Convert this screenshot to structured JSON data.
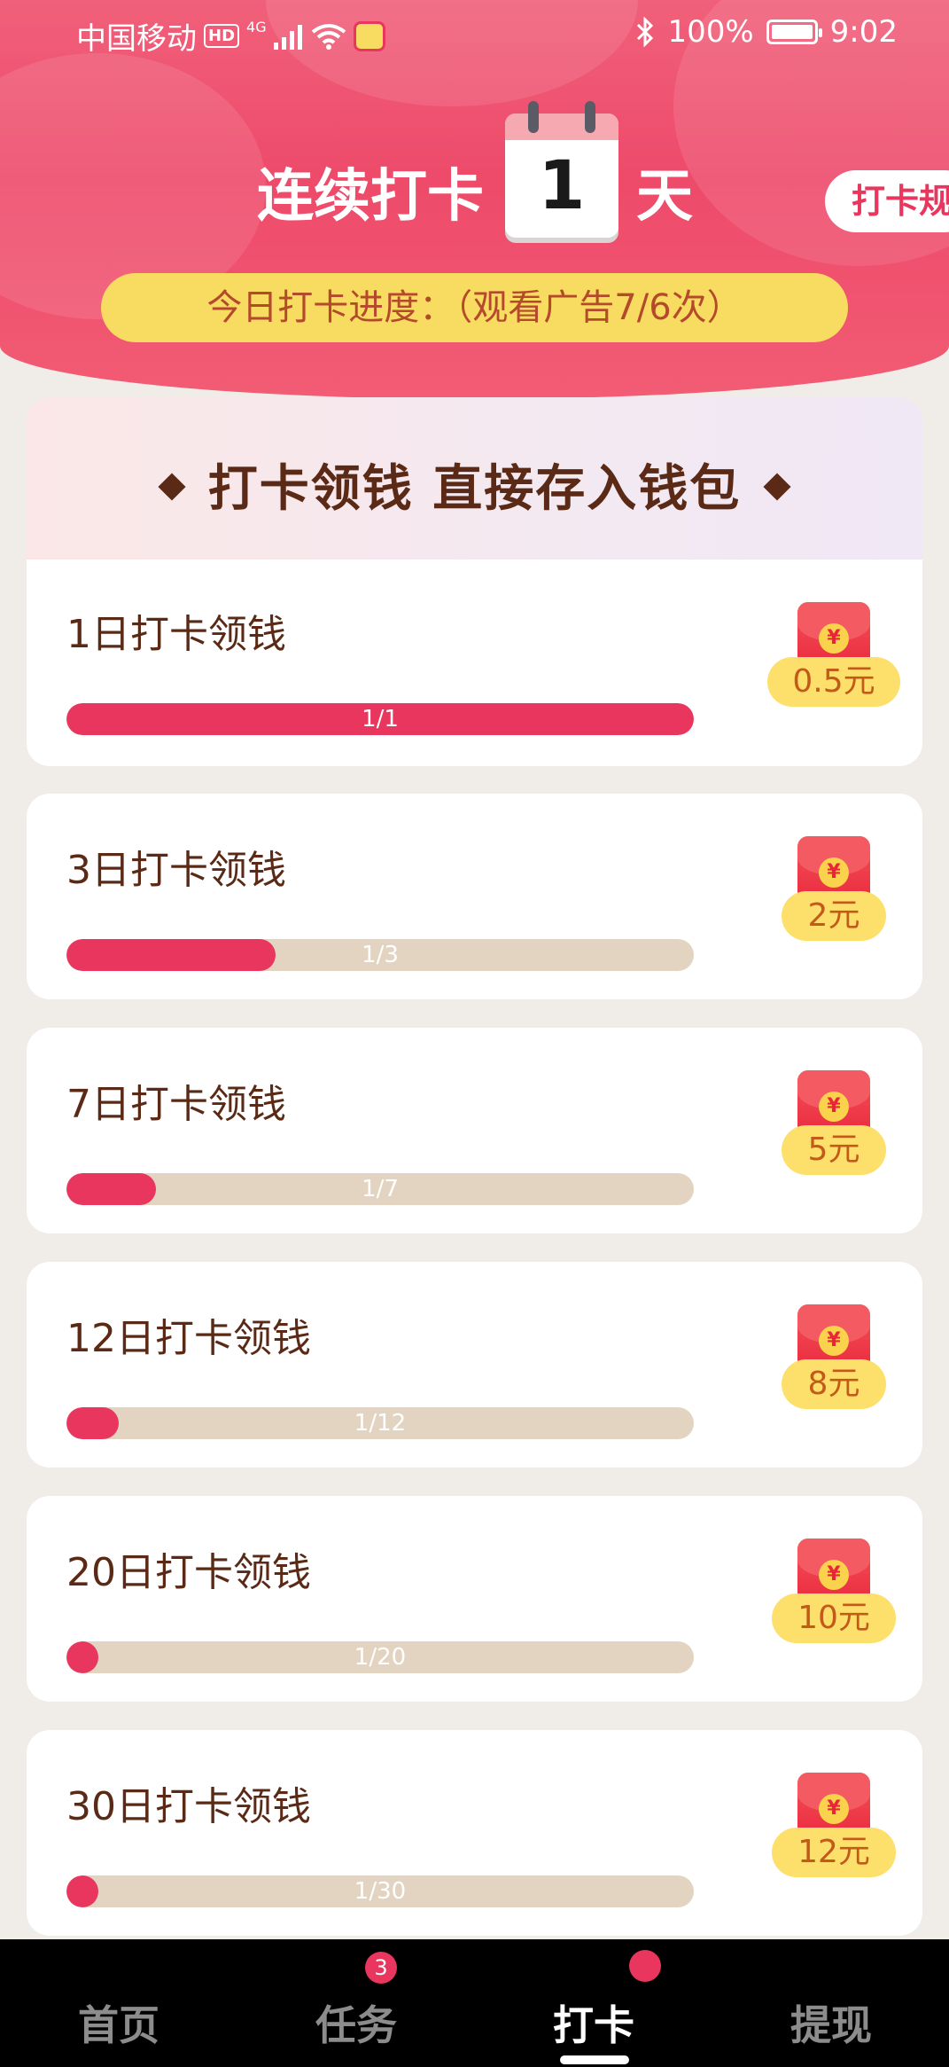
{
  "status_bar": {
    "carrier": "中国移动",
    "hd": "HD",
    "network": "4G",
    "battery": "100%",
    "time": "9:02"
  },
  "header": {
    "streak_prefix": "连续打卡",
    "streak_days": "1",
    "streak_suffix": "天",
    "rules_button": "打卡规则",
    "today_progress": "今日打卡进度：（观看广告7/6次）"
  },
  "banner": {
    "title": "打卡领钱 直接存入钱包"
  },
  "cards": [
    {
      "title": "1日打卡领钱",
      "progress_label": "1/1",
      "progress": 1.0,
      "reward": "0.5元"
    },
    {
      "title": "3日打卡领钱",
      "progress_label": "1/3",
      "progress": 0.3333,
      "reward": "2元"
    },
    {
      "title": "7日打卡领钱",
      "progress_label": "1/7",
      "progress": 0.1429,
      "reward": "5元"
    },
    {
      "title": "12日打卡领钱",
      "progress_label": "1/12",
      "progress": 0.0833,
      "reward": "8元"
    },
    {
      "title": "20日打卡领钱",
      "progress_label": "1/20",
      "progress": 0.05,
      "reward": "10元"
    },
    {
      "title": "30日打卡领钱",
      "progress_label": "1/30",
      "progress": 0.0333,
      "reward": "12元"
    }
  ],
  "coin_symbol": "¥",
  "tabs": [
    {
      "label": "首页"
    },
    {
      "label": "任务",
      "badge": "3"
    },
    {
      "label": "打卡"
    },
    {
      "label": "提现"
    }
  ],
  "active_tab": "打卡",
  "colors": {
    "accent": "#e8365e",
    "header": "#ee4a6a",
    "pill": "#f8dc62",
    "track": "#e3d4c1",
    "text_brown": "#5a2a16"
  }
}
